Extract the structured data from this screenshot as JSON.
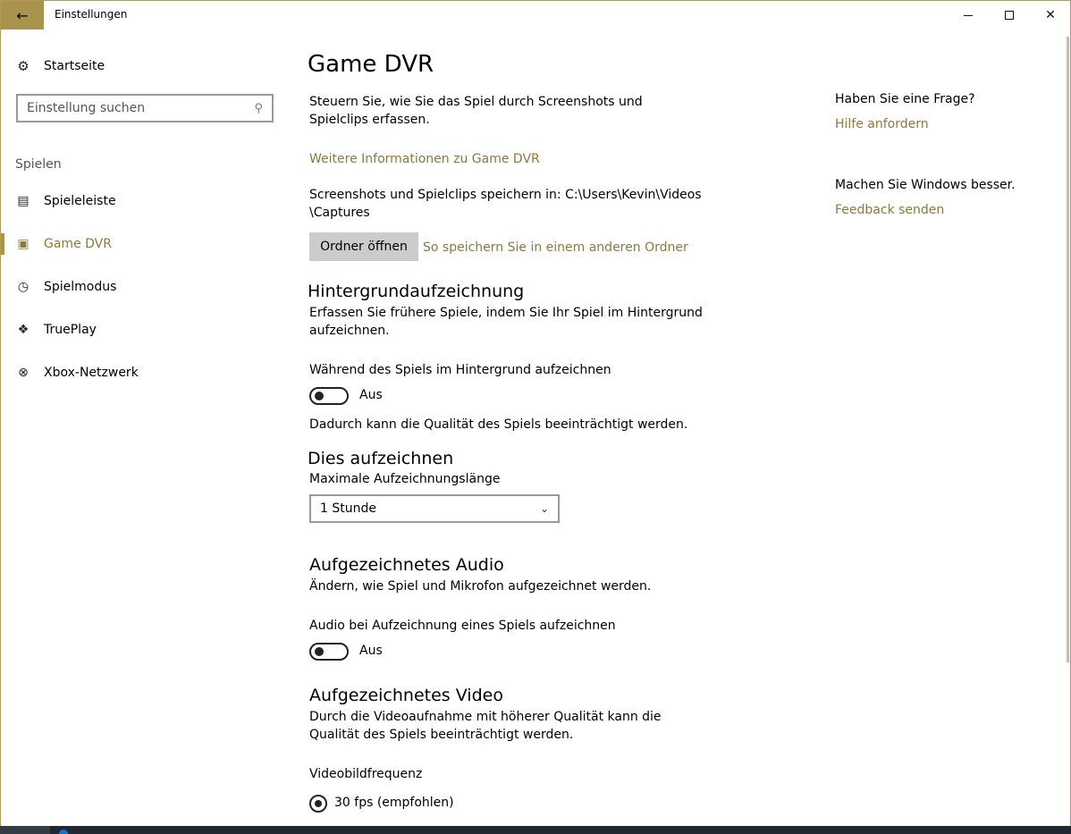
{
  "window": {
    "title": "Einstellungen"
  },
  "sidebar": {
    "home_label": "Startseite",
    "search_placeholder": "Einstellung suchen",
    "section": "Spielen",
    "items": [
      {
        "label": "Spieleleiste",
        "icon": "gamebar-icon",
        "active": false
      },
      {
        "label": "Game DVR",
        "icon": "game-dvr-icon",
        "active": true
      },
      {
        "label": "Spielmodus",
        "icon": "game-mode-icon",
        "active": false
      },
      {
        "label": "TruePlay",
        "icon": "trueplay-icon",
        "active": false
      },
      {
        "label": "Xbox-Netzwerk",
        "icon": "xbox-icon",
        "active": false
      }
    ]
  },
  "main": {
    "title": "Game DVR",
    "intro": "Steuern Sie, wie Sie das Spiel durch Screenshots und Spielclips erfassen.",
    "more_info_link": "Weitere Informationen zu Game DVR",
    "save_location_line1": "Screenshots und Spielclips speichern in: C:\\Users\\Kevin\\Videos",
    "save_location_line2": "\\Captures",
    "open_folder_button": "Ordner öffnen",
    "other_folder_link": "So speichern Sie in einem anderen Ordner",
    "background": {
      "heading": "Hintergrundaufzeichnung",
      "description": "Erfassen Sie frühere Spiele, indem Sie Ihr Spiel im Hintergrund aufzeichnen.",
      "toggle_label": "Während des Spiels im Hintergrund aufzeichnen",
      "toggle_state": "Aus",
      "note": "Dadurch kann die Qualität des Spiels beeinträchtigt werden."
    },
    "record_this": {
      "heading": "Dies aufzeichnen",
      "max_length_label": "Maximale Aufzeichnungslänge",
      "max_length_value": "1 Stunde"
    },
    "audio": {
      "heading": "Aufgezeichnetes Audio",
      "description": "Ändern, wie Spiel und Mikrofon aufgezeichnet werden.",
      "toggle_label": "Audio bei Aufzeichnung eines Spiels aufzeichnen",
      "toggle_state": "Aus"
    },
    "video": {
      "heading": "Aufgezeichnetes Video",
      "description": "Durch die Videoaufnahme mit höherer Qualität kann die Qualität des Spiels beeinträchtigt werden.",
      "framerate_label": "Videobildfrequenz",
      "framerate_option": "30 fps (empfohlen)"
    }
  },
  "help": {
    "question": "Haben Sie eine Frage?",
    "help_link": "Hilfe anfordern",
    "improve": "Machen Sie Windows besser.",
    "feedback_link": "Feedback senden"
  },
  "colors": {
    "accent": "#a9944e",
    "link": "#8a7a3c"
  }
}
